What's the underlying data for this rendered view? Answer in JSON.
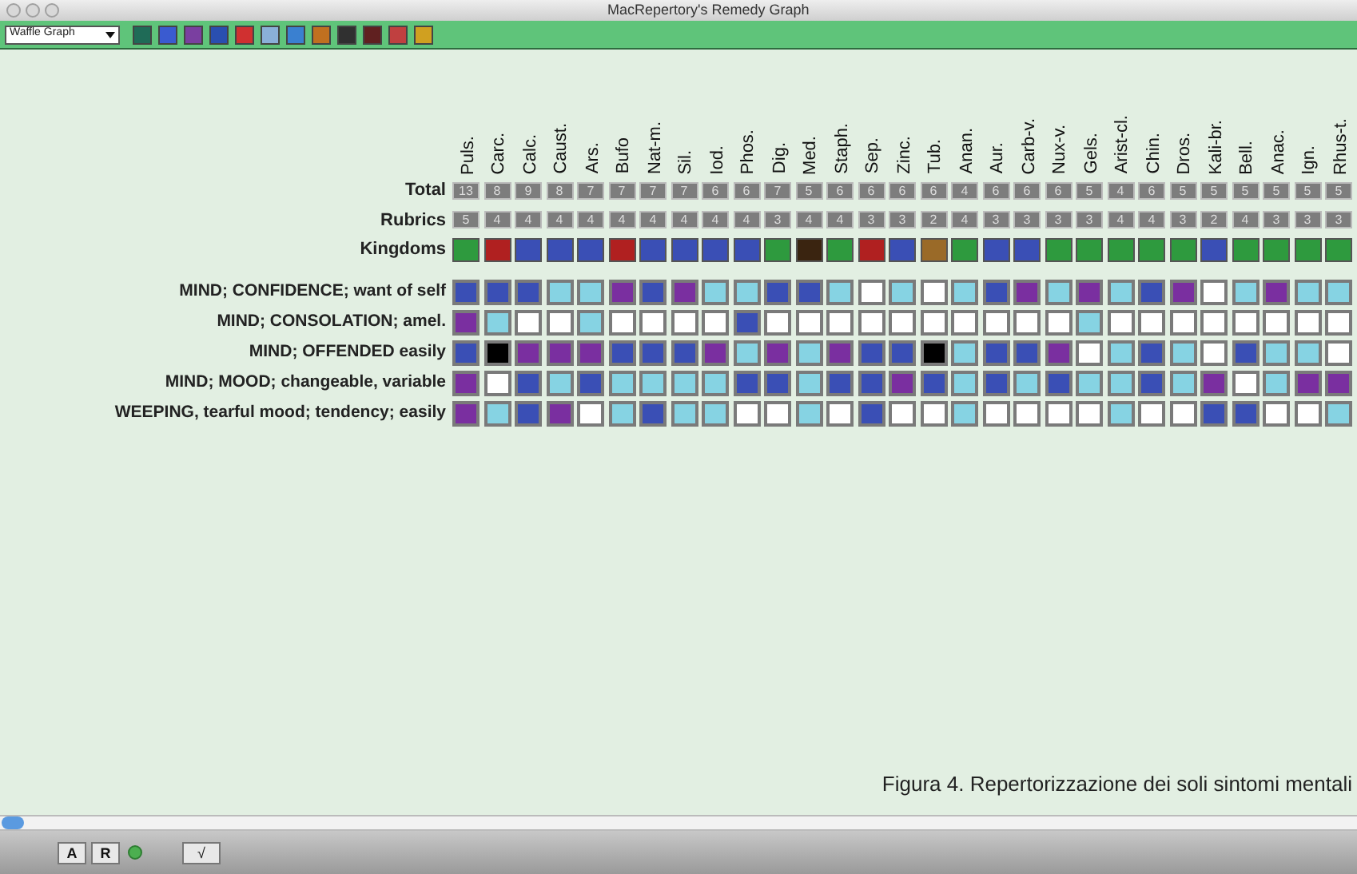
{
  "window": {
    "title": "MacRepertory's Remedy Graph"
  },
  "toolbar": {
    "view_select": "Waffle Graph",
    "icons": [
      {
        "color": "#1f6b57"
      },
      {
        "color": "#3a5bd0"
      },
      {
        "color": "#7a3fa0"
      },
      {
        "color": "#2a4fb0"
      },
      {
        "color": "#d03030"
      },
      {
        "color": "#8ab0d8"
      },
      {
        "color": "#3a80d0"
      },
      {
        "color": "#c07020"
      },
      {
        "color": "#303030"
      },
      {
        "color": "#602020"
      },
      {
        "color": "#c04040"
      },
      {
        "color": "#d0a020"
      }
    ]
  },
  "graph": {
    "row_headers": [
      "Total",
      "Rubrics",
      "Kingdoms"
    ],
    "remedies": [
      {
        "name": "Puls.",
        "total": "13",
        "rubrics": "5",
        "color": "#2e9a3e"
      },
      {
        "name": "Carc.",
        "total": "8",
        "rubrics": "4",
        "color": "#b02020"
      },
      {
        "name": "Calc.",
        "total": "9",
        "rubrics": "4",
        "color": "#3a4fb5"
      },
      {
        "name": "Caust.",
        "total": "8",
        "rubrics": "4",
        "color": "#3a4fb5"
      },
      {
        "name": "Ars.",
        "total": "7",
        "rubrics": "4",
        "color": "#3a4fb5"
      },
      {
        "name": "Bufo",
        "total": "7",
        "rubrics": "4",
        "color": "#b02020"
      },
      {
        "name": "Nat-m.",
        "total": "7",
        "rubrics": "4",
        "color": "#3a4fb5"
      },
      {
        "name": "Sil.",
        "total": "7",
        "rubrics": "4",
        "color": "#3a4fb5"
      },
      {
        "name": "Iod.",
        "total": "6",
        "rubrics": "4",
        "color": "#3a4fb5"
      },
      {
        "name": "Phos.",
        "total": "6",
        "rubrics": "4",
        "color": "#3a4fb5"
      },
      {
        "name": "Dig.",
        "total": "7",
        "rubrics": "3",
        "color": "#2e9a3e"
      },
      {
        "name": "Med.",
        "total": "5",
        "rubrics": "4",
        "color": "#3a2410"
      },
      {
        "name": "Staph.",
        "total": "6",
        "rubrics": "4",
        "color": "#2e9a3e"
      },
      {
        "name": "Sep.",
        "total": "6",
        "rubrics": "3",
        "color": "#b02020"
      },
      {
        "name": "Zinc.",
        "total": "6",
        "rubrics": "3",
        "color": "#3a4fb5"
      },
      {
        "name": "Tub.",
        "total": "6",
        "rubrics": "2",
        "color": "#9a6a28"
      },
      {
        "name": "Anan.",
        "total": "4",
        "rubrics": "4",
        "color": "#2e9a3e"
      },
      {
        "name": "Aur.",
        "total": "6",
        "rubrics": "3",
        "color": "#3a4fb5"
      },
      {
        "name": "Carb-v.",
        "total": "6",
        "rubrics": "3",
        "color": "#3a4fb5"
      },
      {
        "name": "Nux-v.",
        "total": "6",
        "rubrics": "3",
        "color": "#2e9a3e"
      },
      {
        "name": "Gels.",
        "total": "5",
        "rubrics": "3",
        "color": "#2e9a3e"
      },
      {
        "name": "Arist-cl.",
        "total": "4",
        "rubrics": "4",
        "color": "#2e9a3e"
      },
      {
        "name": "Chin.",
        "total": "6",
        "rubrics": "4",
        "color": "#2e9a3e"
      },
      {
        "name": "Dros.",
        "total": "5",
        "rubrics": "3",
        "color": "#2e9a3e"
      },
      {
        "name": "Kali-br.",
        "total": "5",
        "rubrics": "2",
        "color": "#3a4fb5"
      },
      {
        "name": "Bell.",
        "total": "5",
        "rubrics": "4",
        "color": "#2e9a3e"
      },
      {
        "name": "Anac.",
        "total": "5",
        "rubrics": "3",
        "color": "#2e9a3e"
      },
      {
        "name": "Ign.",
        "total": "5",
        "rubrics": "3",
        "color": "#2e9a3e"
      },
      {
        "name": "Rhus-t.",
        "total": "5",
        "rubrics": "3",
        "color": "#2e9a3e"
      }
    ],
    "rubric_rows": [
      {
        "label": "MIND; CONFIDENCE; want of self",
        "cells": [
          {
            "color": "#3a4fb5"
          },
          {
            "color": "#3a4fb5"
          },
          {
            "color": "#3a4fb5"
          },
          {
            "color": "#86d3e3"
          },
          {
            "color": "#86d3e3"
          },
          {
            "color": "#7a2fa0"
          },
          {
            "color": "#3a4fb5"
          },
          {
            "color": "#7a2fa0"
          },
          {
            "color": "#86d3e3"
          },
          {
            "color": "#86d3e3"
          },
          {
            "color": "#3a4fb5"
          },
          {
            "color": "#3a4fb5"
          },
          {
            "color": "#86d3e3"
          },
          {
            "color": "#ffffff"
          },
          {
            "color": "#86d3e3"
          },
          {
            "color": "#ffffff"
          },
          {
            "color": "#86d3e3"
          },
          {
            "color": "#3a4fb5"
          },
          {
            "color": "#7a2fa0"
          },
          {
            "color": "#86d3e3"
          },
          {
            "color": "#7a2fa0"
          },
          {
            "color": "#86d3e3"
          },
          {
            "color": "#3a4fb5"
          },
          {
            "color": "#7a2fa0"
          },
          {
            "color": "#ffffff"
          },
          {
            "color": "#86d3e3"
          },
          {
            "color": "#7a2fa0"
          },
          {
            "color": "#86d3e3"
          },
          {
            "color": "#86d3e3"
          }
        ]
      },
      {
        "label": "MIND; CONSOLATION; amel.",
        "cells": [
          {
            "color": "#7a2fa0"
          },
          {
            "color": "#86d3e3"
          },
          {
            "color": "#ffffff"
          },
          {
            "color": "#ffffff"
          },
          {
            "color": "#86d3e3"
          },
          {
            "color": "#ffffff"
          },
          {
            "color": "#ffffff"
          },
          {
            "color": "#ffffff"
          },
          {
            "color": "#ffffff"
          },
          {
            "color": "#3a4fb5"
          },
          {
            "color": "#ffffff"
          },
          {
            "color": "#ffffff"
          },
          {
            "color": "#ffffff"
          },
          {
            "color": "#ffffff"
          },
          {
            "color": "#ffffff"
          },
          {
            "color": "#ffffff"
          },
          {
            "color": "#ffffff"
          },
          {
            "color": "#ffffff"
          },
          {
            "color": "#ffffff"
          },
          {
            "color": "#ffffff"
          },
          {
            "color": "#86d3e3"
          },
          {
            "color": "#ffffff"
          },
          {
            "color": "#ffffff"
          },
          {
            "color": "#ffffff"
          },
          {
            "color": "#ffffff"
          },
          {
            "color": "#ffffff"
          },
          {
            "color": "#ffffff"
          },
          {
            "color": "#ffffff"
          },
          {
            "color": "#ffffff"
          }
        ]
      },
      {
        "label": "MIND; OFFENDED easily",
        "cells": [
          {
            "color": "#3a4fb5"
          },
          {
            "color": "#000000"
          },
          {
            "color": "#7a2fa0"
          },
          {
            "color": "#7a2fa0"
          },
          {
            "color": "#7a2fa0"
          },
          {
            "color": "#3a4fb5"
          },
          {
            "color": "#3a4fb5"
          },
          {
            "color": "#3a4fb5"
          },
          {
            "color": "#7a2fa0"
          },
          {
            "color": "#86d3e3"
          },
          {
            "color": "#7a2fa0"
          },
          {
            "color": "#86d3e3"
          },
          {
            "color": "#7a2fa0"
          },
          {
            "color": "#3a4fb5"
          },
          {
            "color": "#3a4fb5"
          },
          {
            "color": "#000000"
          },
          {
            "color": "#86d3e3"
          },
          {
            "color": "#3a4fb5"
          },
          {
            "color": "#3a4fb5"
          },
          {
            "color": "#7a2fa0"
          },
          {
            "color": "#ffffff"
          },
          {
            "color": "#86d3e3"
          },
          {
            "color": "#3a4fb5"
          },
          {
            "color": "#86d3e3"
          },
          {
            "color": "#ffffff"
          },
          {
            "color": "#3a4fb5"
          },
          {
            "color": "#86d3e3"
          },
          {
            "color": "#86d3e3"
          },
          {
            "color": "#ffffff"
          }
        ]
      },
      {
        "label": "MIND; MOOD; changeable, variable",
        "cells": [
          {
            "color": "#7a2fa0"
          },
          {
            "color": "#ffffff"
          },
          {
            "color": "#3a4fb5"
          },
          {
            "color": "#86d3e3"
          },
          {
            "color": "#3a4fb5"
          },
          {
            "color": "#86d3e3"
          },
          {
            "color": "#86d3e3"
          },
          {
            "color": "#86d3e3"
          },
          {
            "color": "#86d3e3"
          },
          {
            "color": "#3a4fb5"
          },
          {
            "color": "#3a4fb5"
          },
          {
            "color": "#86d3e3"
          },
          {
            "color": "#3a4fb5"
          },
          {
            "color": "#3a4fb5"
          },
          {
            "color": "#7a2fa0"
          },
          {
            "color": "#3a4fb5"
          },
          {
            "color": "#86d3e3"
          },
          {
            "color": "#3a4fb5"
          },
          {
            "color": "#86d3e3"
          },
          {
            "color": "#3a4fb5"
          },
          {
            "color": "#86d3e3"
          },
          {
            "color": "#86d3e3"
          },
          {
            "color": "#3a4fb5"
          },
          {
            "color": "#86d3e3"
          },
          {
            "color": "#7a2fa0"
          },
          {
            "color": "#ffffff"
          },
          {
            "color": "#86d3e3"
          },
          {
            "color": "#7a2fa0"
          },
          {
            "color": "#7a2fa0"
          }
        ]
      },
      {
        "label": "WEEPING, tearful mood; tendency; easily",
        "cells": [
          {
            "color": "#7a2fa0"
          },
          {
            "color": "#86d3e3"
          },
          {
            "color": "#3a4fb5"
          },
          {
            "color": "#7a2fa0"
          },
          {
            "color": "#ffffff"
          },
          {
            "color": "#86d3e3"
          },
          {
            "color": "#3a4fb5"
          },
          {
            "color": "#86d3e3"
          },
          {
            "color": "#86d3e3"
          },
          {
            "color": "#ffffff"
          },
          {
            "color": "#ffffff"
          },
          {
            "color": "#86d3e3"
          },
          {
            "color": "#ffffff"
          },
          {
            "color": "#3a4fb5"
          },
          {
            "color": "#ffffff"
          },
          {
            "color": "#ffffff"
          },
          {
            "color": "#86d3e3"
          },
          {
            "color": "#ffffff"
          },
          {
            "color": "#ffffff"
          },
          {
            "color": "#ffffff"
          },
          {
            "color": "#ffffff"
          },
          {
            "color": "#86d3e3"
          },
          {
            "color": "#ffffff"
          },
          {
            "color": "#ffffff"
          },
          {
            "color": "#3a4fb5"
          },
          {
            "color": "#3a4fb5"
          },
          {
            "color": "#ffffff"
          },
          {
            "color": "#ffffff"
          },
          {
            "color": "#86d3e3"
          }
        ]
      }
    ]
  },
  "caption": "Figura 4. Repertorizzazione dei soli sintomi mentali",
  "bottom_bar": {
    "buttons": [
      "A",
      "R"
    ],
    "formula_button": "√"
  }
}
